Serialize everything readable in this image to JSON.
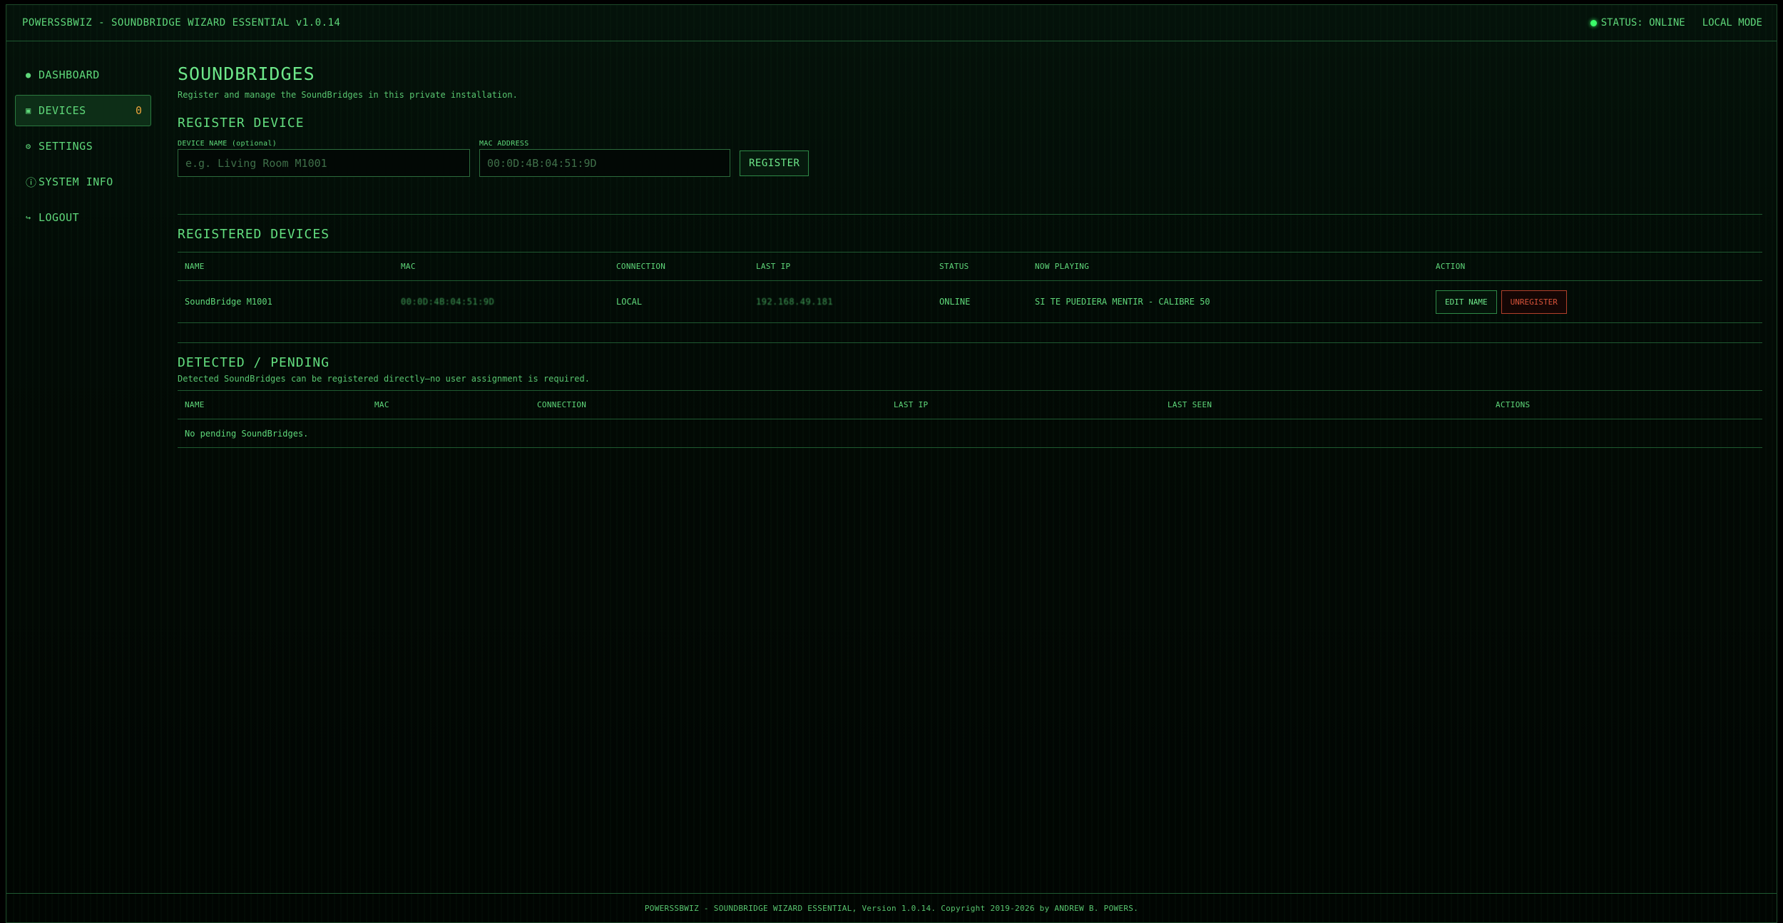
{
  "app": {
    "title": "POWERSSBWIZ - SOUNDBRIDGE WIZARD ESSENTIAL v1.0.14",
    "status": "STATUS: ONLINE",
    "mode": "LOCAL MODE"
  },
  "sidebar": {
    "items": [
      {
        "label": "DASHBOARD",
        "icon": "●"
      },
      {
        "label": "DEVICES",
        "icon": "▣",
        "badge": "0"
      },
      {
        "label": "SETTINGS",
        "icon": "⚙"
      },
      {
        "label": "SYSTEM INFO",
        "icon": "ⓘ"
      },
      {
        "label": "LOGOUT",
        "icon": "↪"
      }
    ]
  },
  "page": {
    "title": "SOUNDBRIDGES",
    "subtitle": "Register and manage the SoundBridges in this private installation."
  },
  "register": {
    "title": "REGISTER DEVICE",
    "name_label": "DEVICE NAME (optional)",
    "name_placeholder": "e.g. Living Room M1001",
    "mac_label": "MAC ADDRESS",
    "mac_placeholder": "00:0D:4B:04:51:9D",
    "button": "REGISTER"
  },
  "registered": {
    "title": "REGISTERED DEVICES",
    "columns": [
      "NAME",
      "MAC",
      "CONNECTION",
      "LAST IP",
      "STATUS",
      "NOW PLAYING",
      "ACTION"
    ],
    "rows": [
      {
        "name": "SoundBridge M1001",
        "mac": "00:0D:4B:04:51:9D",
        "connection": "LOCAL",
        "last_ip": "192.168.49.181",
        "status": "ONLINE",
        "now_playing": "SI TE PUEDIERA MENTIR - CALIBRE 50",
        "edit_label": "EDIT NAME",
        "unregister_label": "UNREGISTER"
      }
    ]
  },
  "pending": {
    "title": "DETECTED / PENDING",
    "subtitle": "Detected SoundBridges can be registered directly—no user assignment is required.",
    "columns": [
      "NAME",
      "MAC",
      "CONNECTION",
      "LAST IP",
      "LAST SEEN",
      "ACTIONS"
    ],
    "empty": "No pending SoundBridges."
  },
  "footer": {
    "text": "POWERSSBWIZ - SOUNDBRIDGE WIZARD ESSENTIAL, Version 1.0.14. Copyright 2019-2026 by ANDREW B. POWERS."
  },
  "colors": {
    "accent": "#5fd87a",
    "background": "#000000",
    "badge": "#e8a23a",
    "danger": "#d9533a",
    "status_dot": "#3bff6a"
  }
}
